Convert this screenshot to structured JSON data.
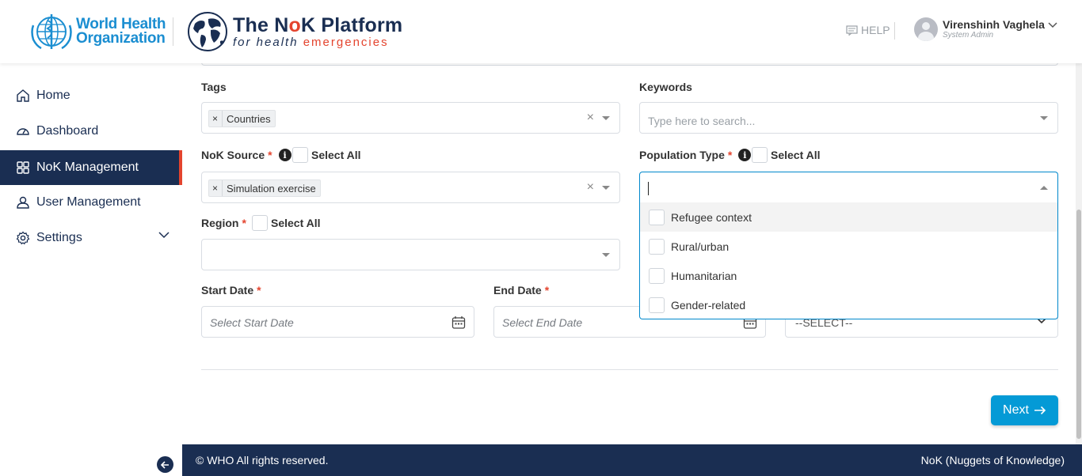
{
  "header": {
    "who_line1": "World Health",
    "who_line2": "Organization",
    "platform_title_pre": "The N",
    "platform_title_o": "o",
    "platform_title_post": "K Platform",
    "platform_sub_pre": "for health ",
    "platform_sub_em": "emergencies",
    "help": "HELP",
    "user_name": "Virenshinh Vaghela",
    "user_role": "System Admin"
  },
  "sidebar": {
    "items": [
      {
        "label": "Home",
        "icon": "home-icon"
      },
      {
        "label": "Dashboard",
        "icon": "gauge-icon"
      },
      {
        "label": "NoK Management",
        "icon": "grid-icon",
        "active": true
      },
      {
        "label": "User Management",
        "icon": "user-icon"
      },
      {
        "label": "Settings",
        "icon": "gear-icon"
      }
    ]
  },
  "form": {
    "tags_label": "Tags",
    "tags_value": "Countries",
    "keywords_label": "Keywords",
    "keywords_placeholder": "Type here to search...",
    "source_label": "NoK Source",
    "source_value": "Simulation exercise",
    "population_label": "Population Type",
    "region_label": "Region",
    "select_all": "Select All",
    "start_label": "Start Date",
    "start_placeholder": "Select Start Date",
    "end_label": "End Date",
    "end_placeholder": "Select End Date",
    "extra_select_value": "--SELECT--",
    "required_mark": "*",
    "clear_symbol": "×",
    "info_symbol": "i"
  },
  "dropdown": {
    "options": [
      "Refugee context",
      "Rural/urban",
      "Humanitarian",
      "Gender-related"
    ]
  },
  "actions": {
    "next": "Next"
  },
  "footer": {
    "left": "© WHO All rights reserved.",
    "right": "NoK (Nuggets of Knowledge)"
  },
  "colors": {
    "navy": "#1a2e52",
    "accent_red": "#e4442e",
    "who_blue": "#1b8ed1",
    "button_blue": "#049ad6",
    "focus_border": "#0088cc"
  }
}
